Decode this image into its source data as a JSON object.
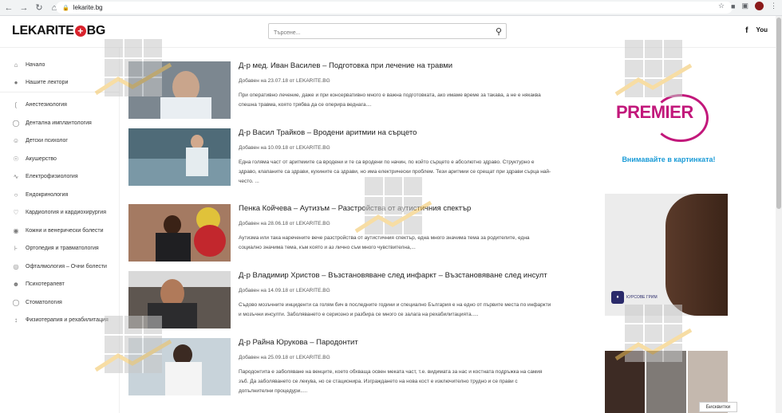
{
  "browser": {
    "url": "lekarite.bg"
  },
  "header": {
    "logo_left": "LEKARITE",
    "logo_right": "BG",
    "search_placeholder": "Търсене...",
    "social": [
      "f",
      "You"
    ]
  },
  "sidebar": {
    "top_items": [
      {
        "label": "Начало",
        "icon": "home-icon"
      },
      {
        "label": "Нашите лектори",
        "icon": "users-icon"
      }
    ],
    "items": [
      {
        "label": "Анестезиология",
        "icon": "syringe-icon"
      },
      {
        "label": "Дентална имплантология",
        "icon": "tooth-icon"
      },
      {
        "label": "Детски психолог",
        "icon": "child-icon"
      },
      {
        "label": "Акушерство",
        "icon": "pregnancy-icon"
      },
      {
        "label": "Електрофизиология",
        "icon": "pulse-icon"
      },
      {
        "label": "Ендокринология",
        "icon": "gland-icon"
      },
      {
        "label": "Кардиология и кардиохирургия",
        "icon": "heart-icon"
      },
      {
        "label": "Кожни и венерически болести",
        "icon": "skin-icon"
      },
      {
        "label": "Ортопедия и травматология",
        "icon": "bone-icon"
      },
      {
        "label": "Офталмология – Очни болести",
        "icon": "eye-icon"
      },
      {
        "label": "Психотерапевт",
        "icon": "head-icon"
      },
      {
        "label": "Стоматология",
        "icon": "dental-icon"
      },
      {
        "label": "Физиотерапия и рехабилитация",
        "icon": "physio-icon"
      }
    ]
  },
  "posts": [
    {
      "title": "Д-р мед. Иван Василев – Подготовка при лечение на травми",
      "meta": "Добавен на 23.07.18 от LEKARITE.BG",
      "excerpt": "При оперативно лечение, даже и при консервативно много е важна подготовката, ако имаме време за такава, а не е някаква спешна травма, която трябва да се оперира веднага....",
      "thumb_color": "#7c8790"
    },
    {
      "title": "Д-р Васил Трайков – Вродени аритмии на сърцето",
      "meta": "Добавен на 10.09.18 от LEKARITE.BG",
      "excerpt": "Една голяма част от аритмиите са вродени и те са вродени по начин, по който сърцето е абсолютно здраво. Структурно е здраво, клапаните са здрави, кухините са здрави, но има електрически проблем. Тези аритмии се срещат при здрави сърца най-често. ...",
      "thumb_color": "#4f6b78"
    },
    {
      "title": "Пенка Койчева – Аутизъм – Разстройства от аутистичния спектър",
      "meta": "Добавен на 28.06.18 от LEKARITE.BG",
      "excerpt": "Аутизма или така наречените вече разстройства от аутистичния спектър, една много значима тема за родителите, една социално значима тема, към която и аз лично съм много чувствителна,...",
      "thumb_color": "#a47a62"
    },
    {
      "title": "Д-р Владимир Христов – Възстановяване след инфаркт – Възстановяване след инсулт",
      "meta": "Добавен на 14.09.18 от LEKARITE.BG",
      "excerpt": "Съдово мозъчните инциденти са голям бич в последните години и специално България е на едно от първите места по инфаркти и мозъчни инсулти. Заболяването е сериозно и разбира се много се залага на рехабилитацията.....",
      "thumb_color": "#5e5650"
    },
    {
      "title": "Д-р Райна Юрукова – Пародонтит",
      "meta": "Добавен на 25.09.18 от LEKARITE.BG",
      "excerpt": "Пародонтита е заболяване на венците, което обхваща освен меката част, т.е. видимата за нас и костната подръжка на самия зъб. Да заболяването се лекува, но се стационира. Изграждането на нова кост е изключително трудно и се прави с допълнителни процедури.....",
      "thumb_color": "#9aa9b3"
    }
  ],
  "ads": {
    "premier_logo": "PREMIER",
    "premier_tagline": "Внимавайте в картинката!",
    "badge_text": "КУРСОВЕ ГРИМ",
    "brand_color": "#c2187b",
    "tagline_color": "#1a9bd7"
  },
  "cookie_button": "Бисквитки"
}
